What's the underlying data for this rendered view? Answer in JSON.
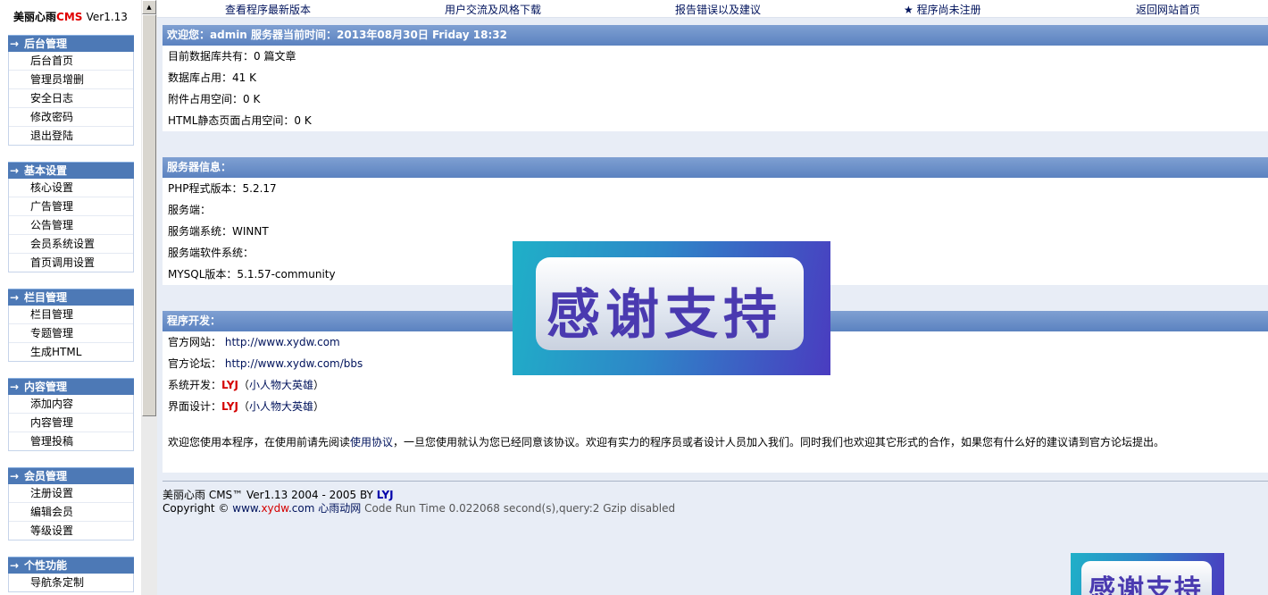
{
  "brand": {
    "name": "美丽心雨",
    "cms": "CMS",
    "version": "Ver1.13"
  },
  "sidebar": {
    "arrow": "→",
    "groups": [
      {
        "title": "后台管理",
        "items": [
          "后台首页",
          "管理员增删",
          "安全日志",
          "修改密码",
          "退出登陆"
        ]
      },
      {
        "title": "基本设置",
        "items": [
          "核心设置",
          "广告管理",
          "公告管理",
          "会员系统设置",
          "首页调用设置"
        ]
      },
      {
        "title": "栏目管理",
        "items": [
          "栏目管理",
          "专题管理",
          "生成HTML"
        ]
      },
      {
        "title": "内容管理",
        "items": [
          "添加内容",
          "内容管理",
          "管理投稿"
        ]
      },
      {
        "title": "会员管理",
        "items": [
          "注册设置",
          "编辑会员",
          "等级设置"
        ]
      },
      {
        "title": "个性功能",
        "items": [
          "导航条定制"
        ]
      }
    ]
  },
  "topnav": [
    "查看程序最新版本",
    "用户交流及风格下载",
    "报告错误以及建议",
    "★ 程序尚未注册",
    "返回网站首页"
  ],
  "welcome": {
    "title": "欢迎您：admin 服务器当前时间：2013年08月30日 Friday 18:32",
    "rows": [
      "目前数据库共有：0 篇文章",
      "数据库占用：41 K",
      "附件占用空间：0 K",
      "HTML静态页面占用空间：0 K"
    ]
  },
  "server": {
    "title": "服务器信息：",
    "rows": [
      "PHP程式版本：5.2.17",
      "服务端：",
      "服务端系统：WINNT",
      "服务端软件系统：",
      "MYSQL版本：5.1.57-community"
    ]
  },
  "dev": {
    "title": "程序开发：",
    "site_label": "官方网站：",
    "site_url": "http://www.xydw.com",
    "forum_label": "官方论坛：",
    "forum_url": "http://www.xydw.com/bbs",
    "developer_label": "系统开发：",
    "designer_label": "界面设计：",
    "author": "LYJ",
    "author_paren_open": "（",
    "author_alias": "小人物大英雄",
    "author_paren_close": "）",
    "notice_pre": "欢迎您使用本程序，在使用前请先阅读",
    "notice_link": "使用协议",
    "notice_post": "，一旦您使用就认为您已经同意该协议。欢迎有实力的程序员或者设计人员加入我们。同时我们也欢迎其它形式的合作，如果您有什么好的建议请到官方论坛提出。"
  },
  "footer": {
    "line1_pre": "美丽心雨 CMS™ Ver1.13 2004 - 2005 BY ",
    "line1_author": "LYJ",
    "copyright": "Copyright ©",
    "site_www": "www.",
    "site_xydw": "xydw",
    "site_com": ".com",
    "site_name": "心雨动网",
    "runtime": "Code Run Time 0.022068 second(s),query:2 Gzip disabled"
  },
  "banner": {
    "text": "感谢支持"
  },
  "colors": {
    "accent": "#4d79b6",
    "background": "#e8edf6",
    "link": "#00135c",
    "author": "#d40000"
  }
}
